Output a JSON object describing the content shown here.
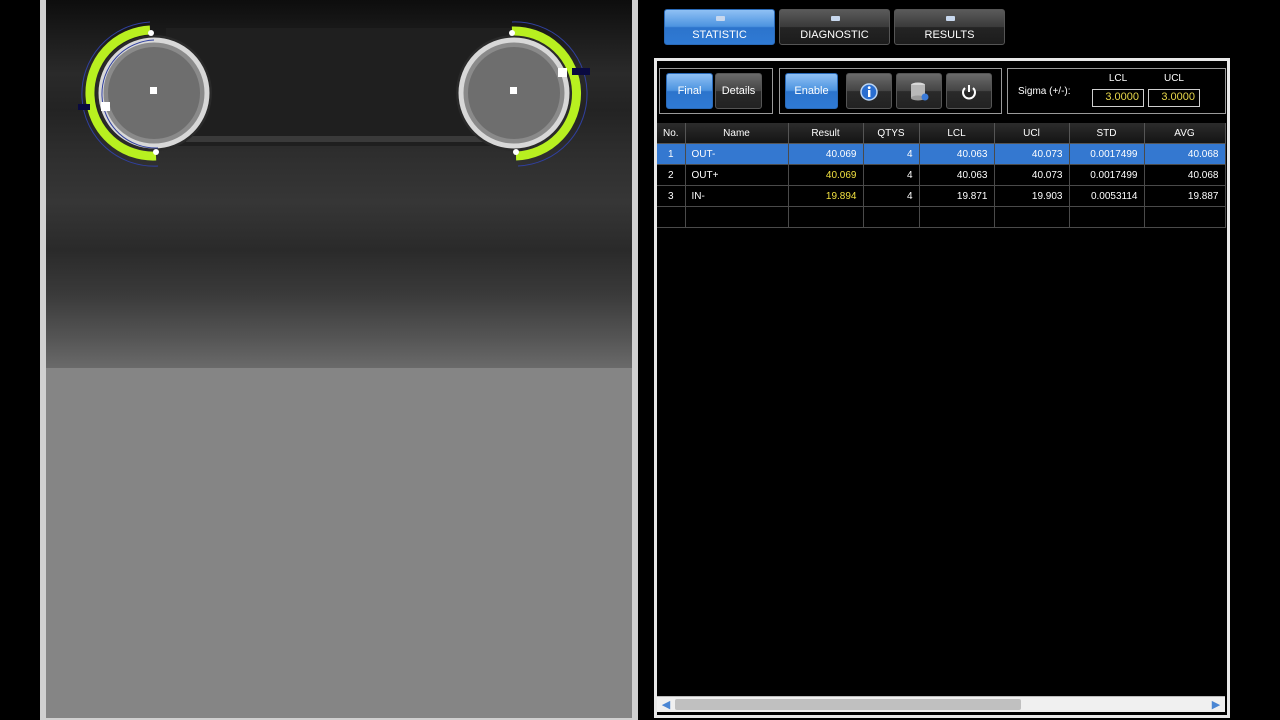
{
  "tabs": [
    {
      "label": "STATISTIC",
      "active": true
    },
    {
      "label": "DIAGNOSTIC",
      "active": false
    },
    {
      "label": "RESULTS",
      "active": false
    }
  ],
  "toolbar": {
    "final_label": "Final",
    "details_label": "Details",
    "enable_label": "Enable",
    "info_icon": "info-icon",
    "database_icon": "database-icon",
    "reset_icon": "power-icon",
    "sigma_label": "Sigma (+/-):",
    "lcl_header": "LCL",
    "ucl_header": "UCL",
    "lcl_value": "3.0000",
    "ucl_value": "3.0000"
  },
  "grid": {
    "columns": [
      "No.",
      "Name",
      "Result",
      "QTYS",
      "LCL",
      "UCl",
      "STD",
      "AVG"
    ],
    "rows": [
      {
        "no": "1",
        "name": "OUT-",
        "result": "40.069",
        "qtys": "4",
        "lcl": "40.063",
        "ucl": "40.073",
        "std": "0.0017499",
        "avg": "40.068",
        "selected": true
      },
      {
        "no": "2",
        "name": "OUT+",
        "result": "40.069",
        "qtys": "4",
        "lcl": "40.063",
        "ucl": "40.073",
        "std": "0.0017499",
        "avg": "40.068",
        "selected": false
      },
      {
        "no": "3",
        "name": "IN-",
        "result": "19.894",
        "qtys": "4",
        "lcl": "19.871",
        "ucl": "19.903",
        "std": "0.0053114",
        "avg": "19.887",
        "selected": false
      }
    ]
  },
  "colors": {
    "accent": "#3478d0",
    "result_highlight": "#f0e040",
    "overlay_green": "#b8f020"
  }
}
